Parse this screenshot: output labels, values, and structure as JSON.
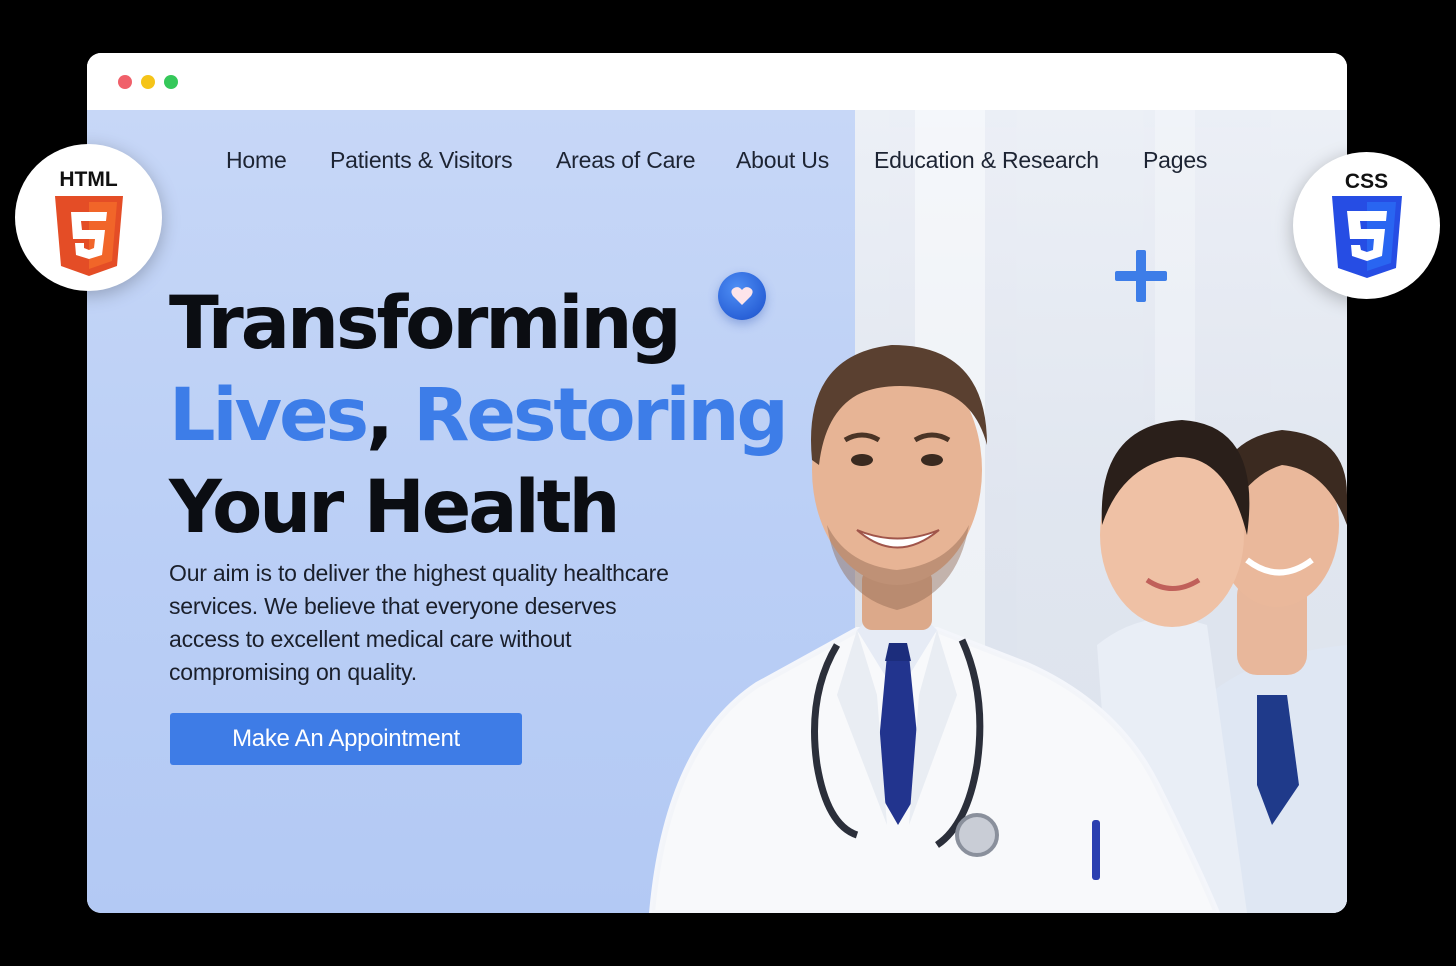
{
  "window": {
    "controls": [
      "close",
      "minimize",
      "maximize"
    ]
  },
  "nav": {
    "items": [
      {
        "label": "Home"
      },
      {
        "label": "Patients & Visitors"
      },
      {
        "label": "Areas of Care"
      },
      {
        "label": "About Us"
      },
      {
        "label": "Education & Research"
      },
      {
        "label": "Pages"
      }
    ]
  },
  "hero": {
    "headline_line1": "Transforming",
    "headline_line2_a": "Lives",
    "headline_line2_sep": ", ",
    "headline_line2_b": "Restoring",
    "headline_line3": "Your Health",
    "description": "Our aim is to deliver the highest quality healthcare services. We believe that everyone deserves access to excellent medical care without compromising on quality.",
    "cta_label": "Make An Appointment"
  },
  "badges": {
    "html_label": "HTML",
    "css_label": "CSS"
  },
  "colors": {
    "accent": "#3d7de8",
    "background": "#c2d4f6",
    "html5_orange": "#e44d26",
    "css3_blue": "#264de4"
  },
  "icons": [
    "heart-icon",
    "plus-icon",
    "html5-icon",
    "css3-icon"
  ]
}
